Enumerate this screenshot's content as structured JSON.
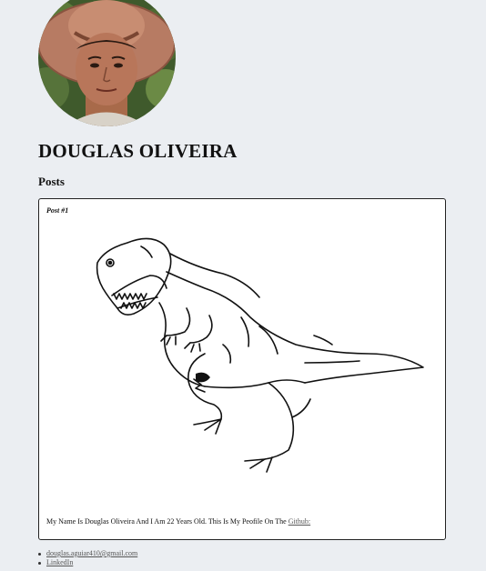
{
  "profile": {
    "name": "DOUGLAS OLIVEIRA",
    "avatar_alt": "profile-photo"
  },
  "posts": {
    "heading": "Posts",
    "items": [
      {
        "title": "Post #1",
        "image": "t-rex-drawing",
        "text": "My Name Is Douglas Oliveira And I Am 22 Years Old. This Is My Peofile On The ",
        "link_label": "Github:"
      }
    ]
  },
  "contacts": [
    {
      "label": "douglas.aguiar410@gmail.com"
    },
    {
      "label": "LinkedIn"
    }
  ],
  "colors": {
    "background": "#ebeef2",
    "card": "#ffffff",
    "border": "#222222",
    "link": "#555555"
  }
}
